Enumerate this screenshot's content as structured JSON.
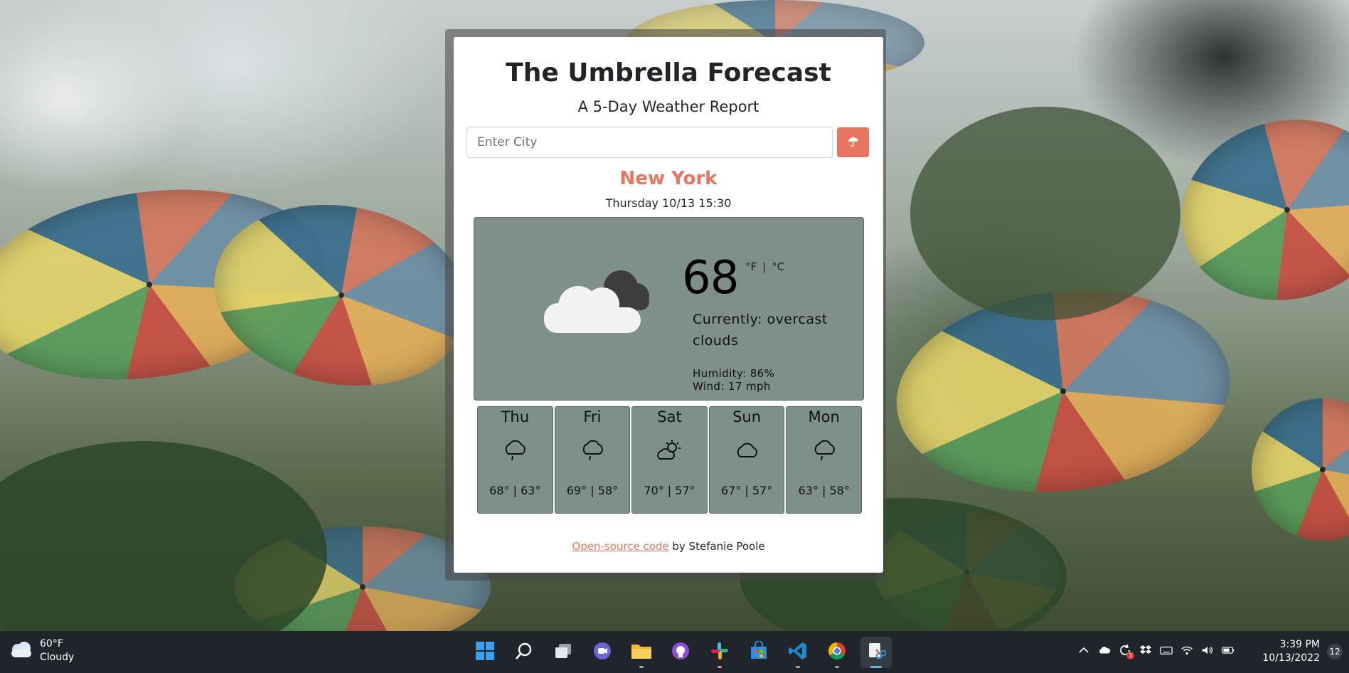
{
  "app": {
    "title": "The Umbrella Forecast",
    "subtitle": "A 5-Day Weather Report",
    "accent_color": "#e8765e",
    "panel_color": "#7f8f8a"
  },
  "search": {
    "value": "",
    "placeholder": "Enter City",
    "button_icon": "umbrella-icon"
  },
  "current": {
    "city": "New York",
    "datetime": "Thursday 10/13 15:30",
    "icon": "overcast-clouds-icon",
    "temperature": "68",
    "unit_f": "°F",
    "unit_separator": "|",
    "unit_c": "°C",
    "conditions": "Currently: overcast clouds",
    "humidity": "Humidity: 86%",
    "wind": "Wind: 17 mph"
  },
  "forecast": [
    {
      "day": "Thu",
      "icon": "rain-cloud-icon",
      "temps": "68° | 63°"
    },
    {
      "day": "Fri",
      "icon": "rain-cloud-icon",
      "temps": "69° | 58°"
    },
    {
      "day": "Sat",
      "icon": "partly-sunny-icon",
      "temps": "70° | 57°"
    },
    {
      "day": "Sun",
      "icon": "cloud-icon",
      "temps": "67° | 57°"
    },
    {
      "day": "Mon",
      "icon": "rain-cloud-icon",
      "temps": "63° | 58°"
    }
  ],
  "footer": {
    "link_text": "Open-source code",
    "suffix": " by Stefanie Poole"
  },
  "taskbar": {
    "weather_temp": "60°F",
    "weather_desc": "Cloudy",
    "apps": [
      "start-icon",
      "search-icon",
      "task-view-icon",
      "chat-icon",
      "file-explorer-icon",
      "github-desktop-icon",
      "slack-icon",
      "store-icon",
      "vscode-icon",
      "chrome-icon",
      "snipping-tool-icon"
    ],
    "clock_time": "3:39 PM",
    "clock_date": "10/13/2022",
    "notification_count": "12",
    "update_badge": "3"
  }
}
